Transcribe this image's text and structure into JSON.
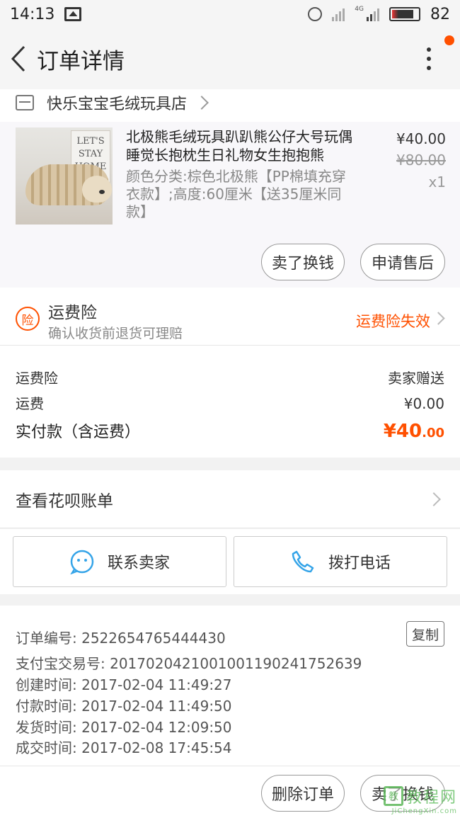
{
  "status_bar": {
    "time": "14:13",
    "network": "4G",
    "battery": "82"
  },
  "header": {
    "title": "订单详情"
  },
  "shop": {
    "name": "快乐宝宝毛绒玩具店"
  },
  "goods": {
    "image_text": "LET'S STAY HOME",
    "title": "北极熊毛绒玩具趴趴熊公仔大号玩偶睡觉长抱枕生日礼物女生抱抱熊",
    "sku": "颜色分类:棕色北极熊【PP棉填充穿衣款】;高度:60厘米【送35厘米同款】",
    "price": "¥40.00",
    "original_price": "¥80.00",
    "quantity": "x1",
    "btn_resell": "卖了换钱",
    "btn_aftersale": "申请售后"
  },
  "insurance": {
    "badge": "险",
    "title": "运费险",
    "subtitle": "确认收货前退货可理赔",
    "status": "运费险失效"
  },
  "summary": {
    "insurance_label": "运费险",
    "insurance_value": "卖家赠送",
    "shipping_label": "运费",
    "shipping_value": "¥0.00",
    "total_label": "实付款（含运费）",
    "total_symbol": "¥",
    "total_int": "40",
    "total_dec": ".00"
  },
  "huabei": {
    "label": "查看花呗账单"
  },
  "contact": {
    "seller": "联系卖家",
    "phone": "拨打电话"
  },
  "order_info": {
    "order_no": "订单编号: 2522654765444430",
    "copy": "复制",
    "alipay_no": "支付宝交易号: 2017020421001001190241752639",
    "created": "创建时间: 2017-02-04 11:49:27",
    "paid": "付款时间: 2017-02-04 11:49:50",
    "shipped": "发货时间: 2017-02-04 12:09:50",
    "completed": "成交时间: 2017-02-08 17:45:54"
  },
  "bottom_bar": {
    "delete": "删除订单",
    "resell": "卖了换钱"
  },
  "watermark": {
    "logo": "教",
    "text": "教程网",
    "url": "JiChengXin.com"
  },
  "colors": {
    "accent": "#ff5000",
    "contact_blue": "#35a4e8"
  }
}
